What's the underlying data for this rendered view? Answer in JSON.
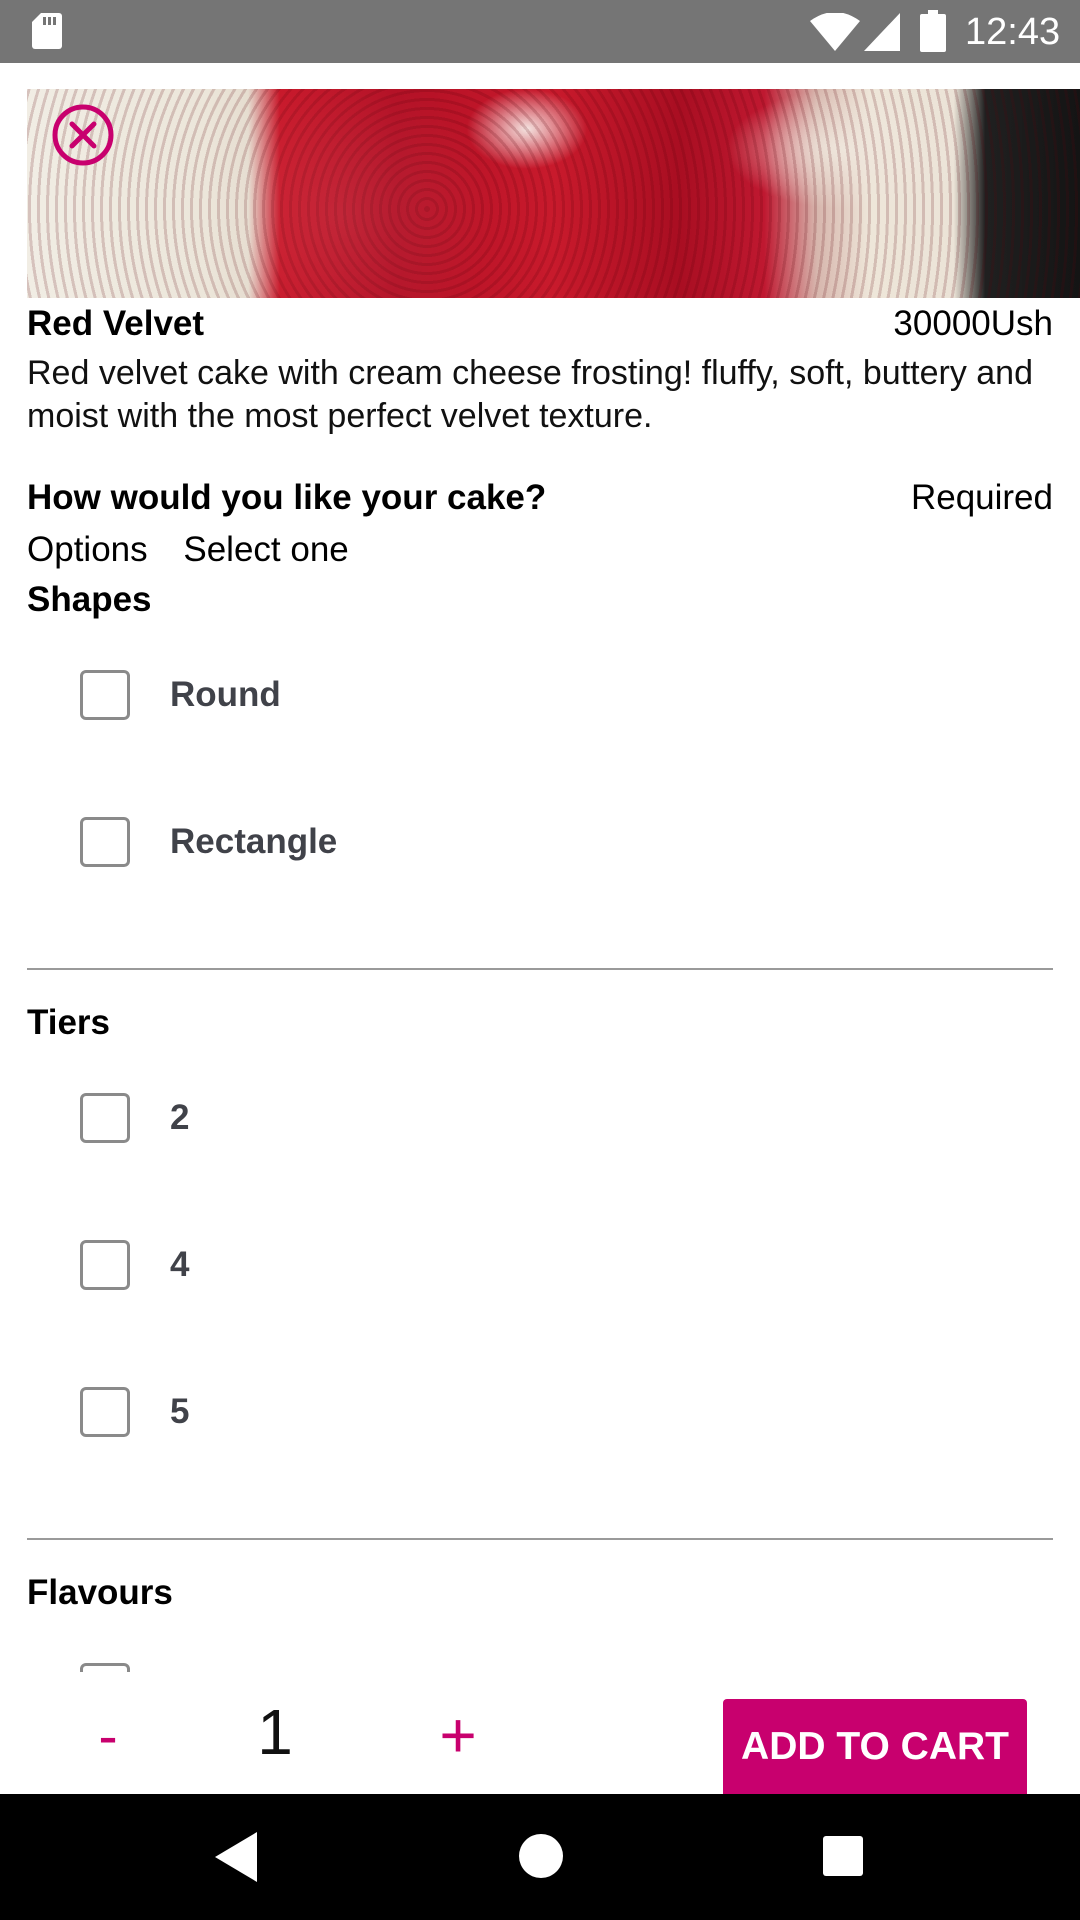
{
  "status_bar": {
    "time": "12:43",
    "icons": [
      "sd-card-icon",
      "wifi-icon",
      "signal-icon",
      "battery-icon"
    ]
  },
  "product": {
    "image_icon": "cake-photo",
    "name": "Red Velvet",
    "price": "30000Ush",
    "description": "Red velvet cake with cream cheese frosting! fluffy, soft, buttery and moist with the most perfect velvet texture."
  },
  "options": {
    "question": "How would you like your cake?",
    "required_label": "Required",
    "options_label": "Options",
    "select_label": "Select one",
    "groups": [
      {
        "title": "Shapes",
        "items": [
          {
            "label": "Round",
            "checked": false
          },
          {
            "label": "Rectangle",
            "checked": false
          }
        ]
      },
      {
        "title": "Tiers",
        "items": [
          {
            "label": "2",
            "checked": false
          },
          {
            "label": "4",
            "checked": false
          },
          {
            "label": "5",
            "checked": false
          }
        ]
      },
      {
        "title": "Flavours",
        "items": []
      }
    ]
  },
  "cart": {
    "minus_label": "-",
    "quantity": "1",
    "plus_label": "+",
    "add_label": "ADD TO CART"
  },
  "colors": {
    "accent": "#c8006e",
    "status_bar": "#757575",
    "nav_bar": "#000000"
  }
}
